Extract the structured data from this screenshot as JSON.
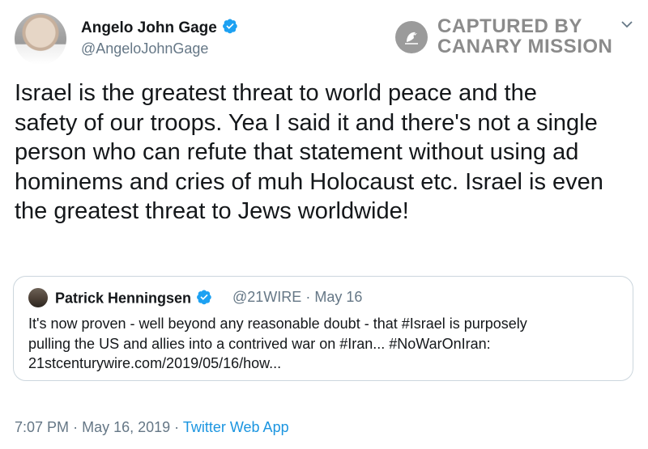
{
  "author": {
    "name": "Angelo John Gage",
    "handle": "@AngeloJohnGage"
  },
  "stamp": {
    "line1": "CAPTURED BY",
    "line2": "CANARY MISSION"
  },
  "tweet": {
    "lines": [
      "Israel is the greatest threat to world peace and the",
      "safety of our troops. Yea I said it and there's not a single",
      "person who can refute that statement without using ad",
      "hominems and cries of muh Holocaust etc. Israel is even",
      "the greatest threat to Jews worldwide!"
    ]
  },
  "quote": {
    "name": "Patrick Henningsen",
    "handle": "@21WIRE",
    "separator": "·",
    "date": "May 16",
    "lines": [
      "It's now proven - well beyond any reasonable doubt - that #Israel is purposely",
      "pulling the US and allies into a contrived war on #Iran... #NoWarOnIran:",
      "21stcenturywire.com/2019/05/16/how..."
    ]
  },
  "footer": {
    "time": "7:07 PM",
    "sep1": "·",
    "date": "May 16, 2019",
    "sep2": "·",
    "app": "Twitter Web App"
  },
  "colors": {
    "verified": "#1da1f2",
    "link": "#1b95e0",
    "muted": "#657786",
    "border": "#ccd6dd"
  },
  "icons": [
    "verified-badge-icon",
    "chevron-down-icon",
    "canary-bird-icon"
  ]
}
